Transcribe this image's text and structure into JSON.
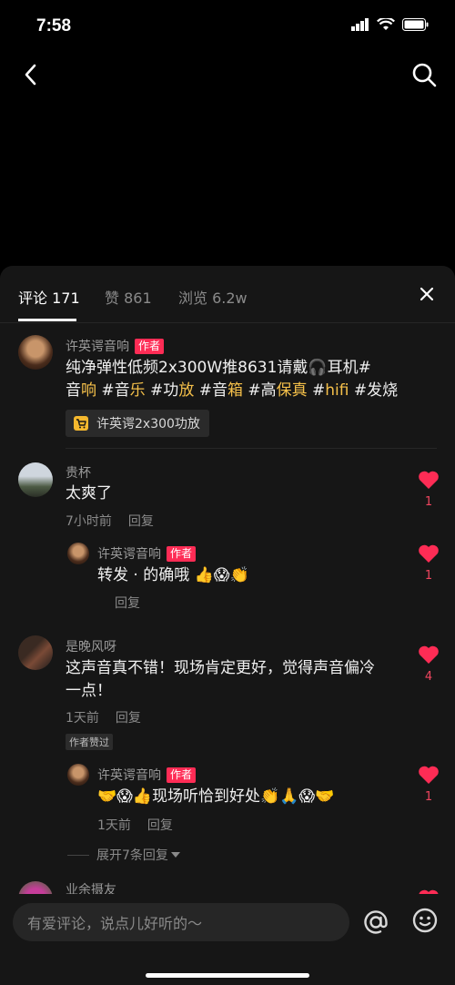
{
  "status": {
    "time": "7:58"
  },
  "tabs": [
    {
      "label": "评论 171"
    },
    {
      "label": "赞 861"
    },
    {
      "label": "浏览 6.2w"
    }
  ],
  "author_badge": "作者",
  "comments": [
    {
      "name": "许英谔音响",
      "text_parts": [
        "纯净弹性低频2x300W推8631请戴",
        "🎧",
        "耳机#",
        "音",
        "响",
        " #音",
        "乐",
        " #功",
        "放",
        " #音",
        "箱",
        " #高",
        "保真",
        " #",
        "hifi",
        " #发烧"
      ],
      "product": "许英谔2x300功放"
    },
    {
      "name": "贵杯",
      "text": "太爽了",
      "time": "7小时前",
      "reply": "回复",
      "likes": "1"
    },
    {
      "name": "许英谔音响",
      "text": "转发 · 的确哦",
      "emojis": "👍😱👏",
      "reply": "回复",
      "likes": "1"
    },
    {
      "name": "是晚风呀",
      "text_line1": "这声音真不错！现场肯定更好，觉得声音偏冷",
      "text_line2": "一点！",
      "time": "1天前",
      "reply": "回复",
      "liked_tag": "作者赞过",
      "likes": "4"
    },
    {
      "name": "许英谔音响",
      "emojis_pre": "🤝😱👍",
      "text": "现场听恰到好处",
      "emojis_post": "👏🙏😱🤝",
      "time": "1天前",
      "reply": "回复",
      "likes": "1"
    },
    {
      "expand": "展开7条回复"
    },
    {
      "name": "业余摄友"
    }
  ],
  "input": {
    "placeholder": "有爱评论，说点儿好听的～"
  },
  "colors": {
    "accent": "#fe2c55",
    "highlight": "#f5c04a",
    "sheet": "#161616"
  }
}
